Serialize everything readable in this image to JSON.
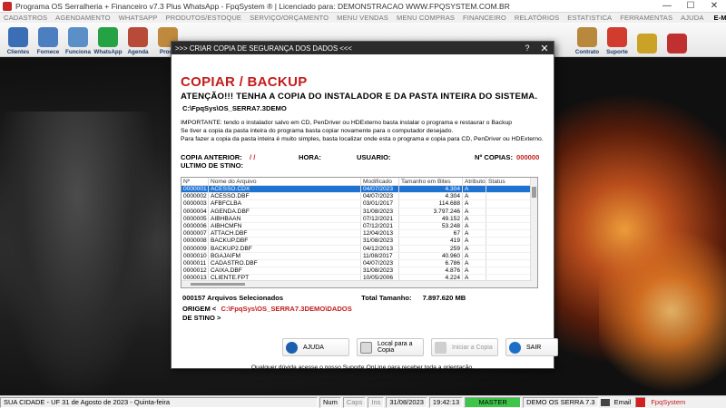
{
  "window": {
    "title": "Programa OS Serralheria + Financeiro v7.3 Plus WhatsApp - FpqSystem ® | Licenciado para: DEMONSTRACAO WWW.FPQSYSTEM.COM.BR",
    "minimize": "—",
    "maximize": "☐",
    "close": "✕"
  },
  "menu": [
    "CADASTROS",
    "AGENDAMENTO",
    "WHATSAPP",
    "PRODUTOS/ESTOQUE",
    "SERVIÇO/ORÇAMENTO",
    "MENU VENDAS",
    "MENU COMPRAS",
    "FINANCEIRO",
    "RELATÓRIOS",
    "ESTATISTICA",
    "FERRAMENTAS",
    "AJUDA"
  ],
  "menu_email": "E-MAIL",
  "toolbar": [
    {
      "label": "Clientes",
      "color": "#3a6fb5"
    },
    {
      "label": "Fornece",
      "color": "#4b7fbf"
    },
    {
      "label": "Funciona",
      "color": "#5b8fc8"
    },
    {
      "label": "WhatsApp",
      "color": "#25a244"
    },
    {
      "label": "Agenda",
      "color": "#b84a3a"
    },
    {
      "label": "Produ",
      "color": "#c08a3e"
    },
    {
      "label": "",
      "color": ""
    },
    {
      "label": "",
      "color": ""
    },
    {
      "label": "",
      "color": ""
    },
    {
      "label": "",
      "color": ""
    },
    {
      "label": "",
      "color": ""
    },
    {
      "label": "",
      "color": ""
    },
    {
      "label": "",
      "color": ""
    },
    {
      "label": "",
      "color": ""
    },
    {
      "label": "",
      "color": ""
    },
    {
      "label": "",
      "color": ""
    },
    {
      "label": "",
      "color": ""
    },
    {
      "label": "",
      "color": ""
    },
    {
      "label": "",
      "color": ""
    },
    {
      "label": "Contrato",
      "color": "#b8883c"
    },
    {
      "label": "Suporte",
      "color": "#d13c2e"
    },
    {
      "label": "",
      "color": "#c9a227"
    },
    {
      "label": "",
      "color": "#c03030"
    }
  ],
  "dialog": {
    "title": ">>> CRIAR COPIA DE SEGURANÇA DOS DADOS <<<",
    "help_glyph": "?",
    "close_glyph": "✕",
    "heading": "COPIAR / BACKUP",
    "attention": "ATENÇÃO!!!  TENHA A COPIA DO  INSTALADOR  E  DA PASTA INTEIRA DO  SISTEMA.",
    "path": "C:\\FpqSys\\OS_SERRA7.3DEMO",
    "info": [
      "IMPORTANTE: tendo o instalador salvo em CD, PenDriver ou HDExterno basta instalar o programa e restaurar o Backup",
      "Se tiver a copia da pasta inteira do programa basta copiar novamente para o computador desejado.",
      "Para fazer a copia da pasta inteira é muito simples, basta localizar onde esta o programa e copia para CD, PenDriver ou HDExterno."
    ],
    "labels": {
      "copy_prev": "COPIA ANTERIOR:",
      "copy_prev_value": "/  /",
      "hour": "HORA:",
      "user": "USUARIO:",
      "copies": "Nº COPIAS:",
      "copies_value": "000000",
      "last_dest": "ULTIMO DE STINO:"
    },
    "grid": {
      "headers": [
        "Nº",
        "Nome do Arquivo",
        "Modificado",
        "Tamanho em Bites",
        "Atributo",
        "Status"
      ],
      "rows": [
        [
          "0000001",
          "ACESSO.CDX",
          "04/07/2023",
          "4.304",
          "A",
          ""
        ],
        [
          "0000002",
          "ACESSO.DBF",
          "04/07/2023",
          "4.304",
          "A",
          ""
        ],
        [
          "0000003",
          "AFBFCLBA",
          "03/01/2017",
          "114.688",
          "A",
          ""
        ],
        [
          "0000004",
          "AGENDA.DBF",
          "31/08/2023",
          "3.797.246",
          "A",
          ""
        ],
        [
          "0000005",
          "AIBHBAAN",
          "07/12/2021",
          "49.152",
          "A",
          ""
        ],
        [
          "0000006",
          "AIBHCMFN",
          "07/12/2021",
          "53.248",
          "A",
          ""
        ],
        [
          "0000007",
          "ATTACH.DBF",
          "12/04/2013",
          "67",
          "A",
          ""
        ],
        [
          "0000008",
          "BACKUP.DBF",
          "31/08/2023",
          "419",
          "A",
          ""
        ],
        [
          "0000009",
          "BACKUP2.DBF",
          "04/12/2013",
          "259",
          "A",
          ""
        ],
        [
          "0000010",
          "BGAJAIFM",
          "11/08/2017",
          "40.960",
          "A",
          ""
        ],
        [
          "0000011",
          "CADASTRO.DBF",
          "04/07/2023",
          "6.786",
          "A",
          ""
        ],
        [
          "0000012",
          "CAIXA.DBF",
          "31/08/2023",
          "4.876",
          "A",
          ""
        ],
        [
          "0000013",
          "CLIENTE.FPT",
          "10/05/2006",
          "4.224",
          "A",
          ""
        ]
      ]
    },
    "summary": {
      "selected": "000157 Arquivos  Selecionados",
      "total_label": "Total Tamanho:",
      "total_value": "7.897.620 MB"
    },
    "origin_label": "ORIGEM  <",
    "origin_value": "C:\\FpqSys\\OS_SERRA7.3DEMO\\DADOS",
    "dest_label": "DE STINO >",
    "buttons": {
      "help": "AJUDA",
      "local": "Local para a Copia",
      "start": "Iniciar a Copia",
      "exit": "SAIR"
    },
    "footer": "Qualquer dúvida acesse o nosso Suporte OnLine para receber toda a orientação."
  },
  "status": {
    "city": "SUA CIDADE - UF 31 de Agosto de 2023 - Quinta-feira",
    "num": "Num",
    "caps": "Caps",
    "ins": "Ins",
    "date": "31/08/2023",
    "time": "19:42:13",
    "master": "MASTER",
    "company": "DEMO OS SERRA 7.3",
    "email": "Email",
    "brand": "FpqSystem"
  }
}
